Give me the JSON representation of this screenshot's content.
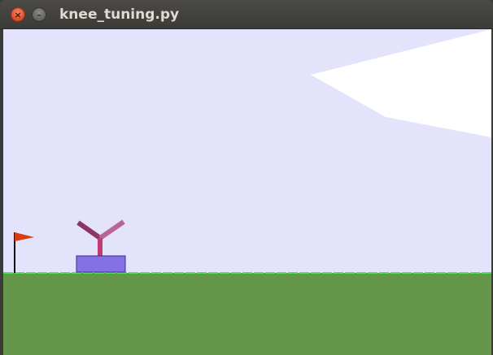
{
  "window": {
    "title": "knee_tuning.py",
    "close_glyph": "×",
    "minimize_glyph": "–"
  },
  "scene": {
    "colors": {
      "sky": "#e3e3fb",
      "cloud": "#ffffff",
      "ground": "#65974b",
      "ground_line": "#4fe04f",
      "flag": "#d83b10",
      "flagpole": "#111111",
      "robot_body": "#8670e6",
      "robot_body_outline": "#3b2d8a",
      "robot_torso": "#c23a6e",
      "robot_left_arm": "#8a3563",
      "robot_right_arm": "#b86496"
    },
    "icons": [
      "close-icon",
      "minimize-icon",
      "flag-icon"
    ]
  }
}
